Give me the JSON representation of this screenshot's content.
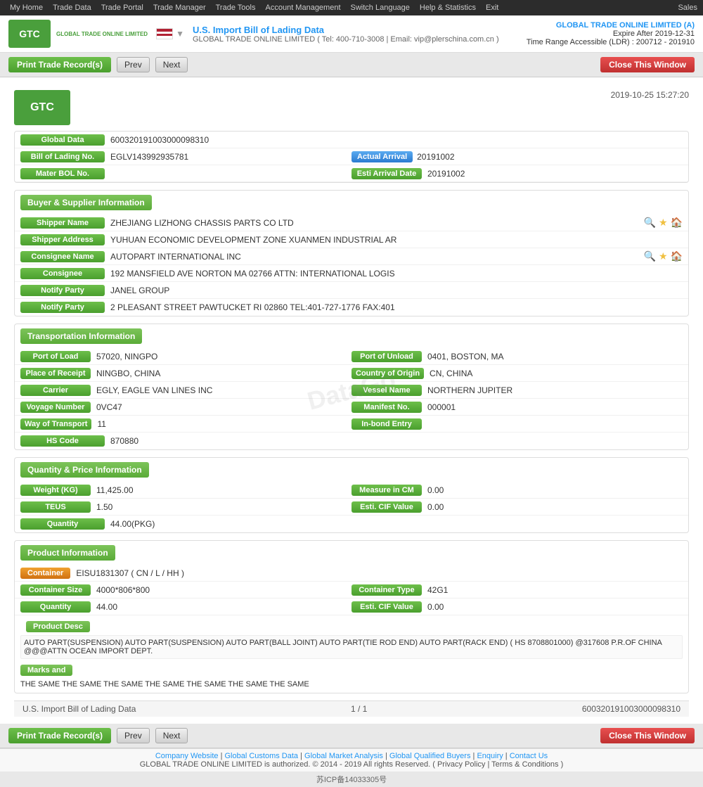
{
  "topnav": {
    "items": [
      "My Home",
      "Trade Data",
      "Trade Portal",
      "Trade Manager",
      "Trade Tools",
      "Account Management",
      "Switch Language",
      "Help & Statistics",
      "Exit"
    ],
    "right": "Sales"
  },
  "header": {
    "logo_text": "GTC",
    "logo_sub": "GLOBAL TRADE ONLINE LIMITED",
    "flag_alt": "US Flag",
    "title": "U.S. Import Bill of Lading Data",
    "contact": "GLOBAL TRADE ONLINE LIMITED ( Tel: 400-710-3008 | Email: vip@plerschina.com.cn )",
    "company": "GLOBAL TRADE ONLINE LIMITED (A)",
    "expire": "Expire After 2019-12-31",
    "time_range": "Time Range Accessible (LDR) : 200712 - 201910"
  },
  "toolbar": {
    "print_label": "Print Trade Record(s)",
    "prev_label": "Prev",
    "next_label": "Next",
    "close_label": "Close This Window"
  },
  "doc": {
    "timestamp": "2019-10-25 15:27:20",
    "global_data_label": "Global Data",
    "global_data_value": "600320191003000098310",
    "bol_label": "Bill of Lading No.",
    "bol_value": "EGLV143992935781",
    "actual_arrival_badge": "Actual Arrival",
    "actual_arrival_date": "20191002",
    "master_bol_label": "Mater BOL No.",
    "esti_arrival_label": "Esti Arrival Date",
    "esti_arrival_value": "20191002"
  },
  "buyer_supplier": {
    "section_title": "Buyer & Supplier Information",
    "shipper_name_label": "Shipper Name",
    "shipper_name_value": "ZHEJIANG LIZHONG CHASSIS PARTS CO LTD",
    "shipper_address_label": "Shipper Address",
    "shipper_address_value": "YUHUAN ECONOMIC DEVELOPMENT ZONE XUANMEN INDUSTRIAL AR",
    "consignee_name_label": "Consignee Name",
    "consignee_name_value": "AUTOPART INTERNATIONAL INC",
    "consignee_label": "Consignee",
    "consignee_value": "192 MANSFIELD AVE NORTON MA 02766 ATTN: INTERNATIONAL LOGIS",
    "notify_party_label": "Notify Party",
    "notify_party_value1": "JANEL GROUP",
    "notify_party_value2": "2 PLEASANT STREET PAWTUCKET RI 02860 TEL:401-727-1776 FAX:401"
  },
  "transport": {
    "section_title": "Transportation Information",
    "port_load_label": "Port of Load",
    "port_load_value": "57020, NINGPO",
    "port_unload_label": "Port of Unload",
    "port_unload_value": "0401, BOSTON, MA",
    "place_receipt_label": "Place of Receipt",
    "place_receipt_value": "NINGBO, CHINA",
    "country_origin_label": "Country of Origin",
    "country_origin_value": "CN, CHINA",
    "carrier_label": "Carrier",
    "carrier_value": "EGLY, EAGLE VAN LINES INC",
    "vessel_label": "Vessel Name",
    "vessel_value": "NORTHERN JUPITER",
    "voyage_label": "Voyage Number",
    "voyage_value": "0VC47",
    "manifest_label": "Manifest No.",
    "manifest_value": "000001",
    "way_transport_label": "Way of Transport",
    "way_transport_value": "11",
    "inbond_label": "In-bond Entry",
    "inbond_value": "",
    "hs_code_label": "HS Code",
    "hs_code_value": "870880"
  },
  "quantity": {
    "section_title": "Quantity & Price Information",
    "weight_label": "Weight (KG)",
    "weight_value": "11,425.00",
    "measure_label": "Measure in CM",
    "measure_value": "0.00",
    "teus_label": "TEUS",
    "teus_value": "1.50",
    "esti_cif_label": "Esti. CIF Value",
    "esti_cif_value": "0.00",
    "quantity_label": "Quantity",
    "quantity_value": "44.00(PKG)"
  },
  "product": {
    "section_title": "Product Information",
    "container_badge": "Container",
    "container_value": "EISU1831307 ( CN / L / HH )",
    "container_size_label": "Container Size",
    "container_size_value": "4000*806*800",
    "container_type_label": "Container Type",
    "container_type_value": "42G1",
    "quantity_label": "Quantity",
    "quantity_value": "44.00",
    "esti_cif_label": "Esti. CIF Value",
    "esti_cif_value": "0.00",
    "product_desc_header": "Product Desc",
    "product_desc_text": "AUTO PART(SUSPENSION) AUTO PART(SUSPENSION) AUTO PART(BALL JOINT) AUTO PART(TIE ROD END) AUTO PART(RACK END) ( HS 8708801000) @317608 P.R.OF CHINA @@@ATTN OCEAN IMPORT DEPT.",
    "marks_header": "Marks and",
    "marks_text": "THE SAME THE SAME THE SAME THE SAME THE SAME THE SAME THE SAME"
  },
  "footer": {
    "title": "U.S. Import Bill of Lading Data",
    "pagination": "1 / 1",
    "record_id": "600320191003000098310"
  },
  "bottom_links": {
    "company_website": "Company Website",
    "global_customs": "Global Customs Data",
    "global_market": "Global Market Analysis",
    "global_buyers": "Global Qualified Buyers",
    "enquiry": "Enquiry",
    "contact_us": "Contact Us",
    "copyright": "GLOBAL TRADE ONLINE LIMITED is authorized. © 2014 - 2019 All rights Reserved.  ( Privacy Policy | Terms & Conditions )",
    "icp": "苏ICP备14033305号"
  }
}
